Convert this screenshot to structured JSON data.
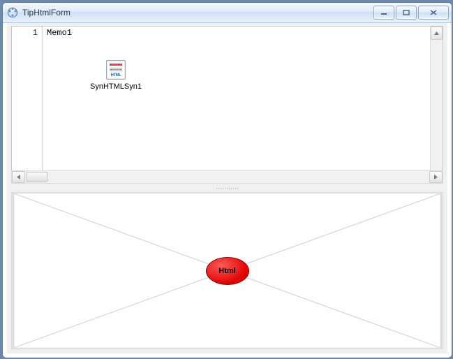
{
  "window": {
    "title": "TipHtmlForm"
  },
  "memo": {
    "line_number": "1",
    "text": "Memo1"
  },
  "component": {
    "label": "SynHTMLSyn1",
    "icon_badge": "HTML"
  },
  "html_panel": {
    "label": "Html"
  }
}
